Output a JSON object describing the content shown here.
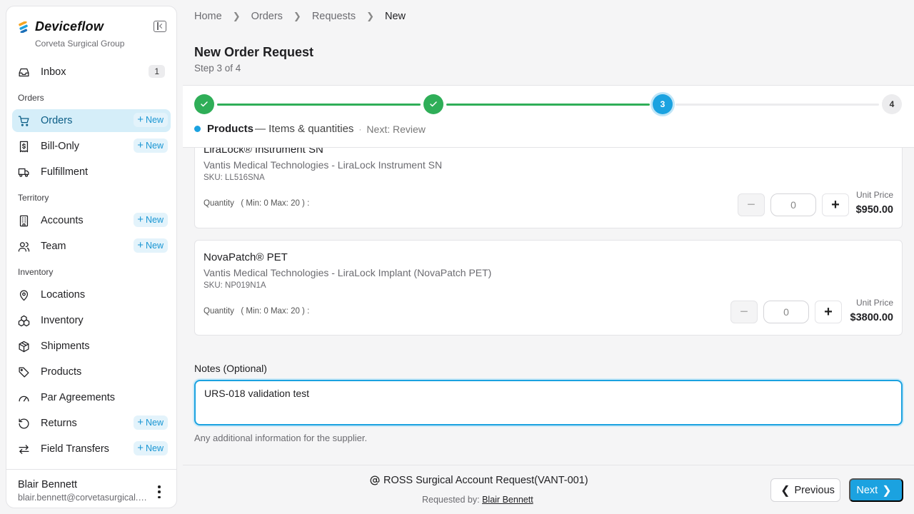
{
  "brand": {
    "name": "Deviceflow",
    "org": "Corveta Surgical Group"
  },
  "sidebar": {
    "inbox": {
      "label": "Inbox",
      "count": "1"
    },
    "sections": {
      "orders": "Orders",
      "territory": "Territory",
      "inventory": "Inventory"
    },
    "new_label": "New",
    "items": {
      "orders": "Orders",
      "bill_only": "Bill-Only",
      "fulfillment": "Fulfillment",
      "accounts": "Accounts",
      "team": "Team",
      "locations": "Locations",
      "inventory": "Inventory",
      "shipments": "Shipments",
      "products": "Products",
      "par_agreements": "Par Agreements",
      "returns": "Returns",
      "field_transfers": "Field Transfers"
    },
    "user": {
      "name": "Blair Bennett",
      "email": "blair.bennett@corvetasurgical.com"
    }
  },
  "breadcrumb": [
    "Home",
    "Orders",
    "Requests",
    "New"
  ],
  "page": {
    "title": "New Order Request",
    "step": "Step 3 of 4"
  },
  "stepper": {
    "step3": "3",
    "step4": "4",
    "current_title": "Products",
    "current_desc": "— Items & quantities",
    "separator": "·",
    "next": "Next: Review"
  },
  "products": [
    {
      "name": "LiraLock® Instrument SN",
      "vendor": "Vantis Medical Technologies - LiraLock Instrument SN",
      "sku": "SKU: LL516SNA",
      "qty_label": "Quantity   ( Min: 0 Max: 20 ) :",
      "qty": "0",
      "price_label": "Unit Price",
      "price": "$950.00"
    },
    {
      "name": "NovaPatch® PET",
      "vendor": "Vantis Medical Technologies - LiraLock Implant (NovaPatch PET)",
      "sku": "SKU: NP019N1A",
      "qty_label": "Quantity   ( Min: 0 Max: 20 ) :",
      "qty": "0",
      "price_label": "Unit Price",
      "price": "$3800.00"
    }
  ],
  "notes": {
    "label": "Notes (Optional)",
    "value": "URS-018 validation test",
    "help": "Any additional information for the supplier."
  },
  "footer": {
    "account": "ROSS Surgical Account Request(VANT-001)",
    "requested_by_label": "Requested by:",
    "requested_by": "Blair Bennett",
    "previous": "Previous",
    "next": "Next"
  }
}
